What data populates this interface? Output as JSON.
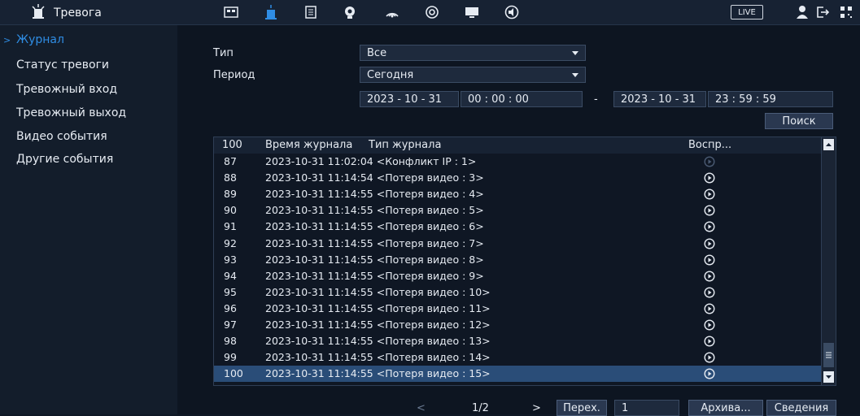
{
  "header": {
    "title": "Тревога",
    "live_label": "LIVE"
  },
  "sidebar": {
    "items": [
      {
        "label": "Журнал"
      },
      {
        "label": "Статус тревоги"
      },
      {
        "label": "Тревожный вход"
      },
      {
        "label": "Тревожный выход"
      },
      {
        "label": "Видео события"
      },
      {
        "label": "Другие события"
      }
    ]
  },
  "filter": {
    "type_label": "Тип",
    "type_value": "Все",
    "period_label": "Период",
    "period_value": "Сегодня",
    "start_date": "2023 - 10 - 31",
    "start_time": "00 : 00 : 00",
    "separator": "-",
    "end_date": "2023 - 10 - 31",
    "end_time": "23 : 59 : 59",
    "search_label": "Поиск"
  },
  "table": {
    "columns": [
      "100",
      "Время журнала",
      "Тип журнала",
      "Воспр..."
    ],
    "rows": [
      {
        "num": "87",
        "text": "2023-10-31 11:02:04 <Конфликт IP : 1>"
      },
      {
        "num": "88",
        "text": "2023-10-31 11:14:54 <Потеря видео : 3>"
      },
      {
        "num": "89",
        "text": "2023-10-31 11:14:55 <Потеря видео : 4>"
      },
      {
        "num": "90",
        "text": "2023-10-31 11:14:55 <Потеря видео : 5>"
      },
      {
        "num": "91",
        "text": "2023-10-31 11:14:55 <Потеря видео : 6>"
      },
      {
        "num": "92",
        "text": "2023-10-31 11:14:55 <Потеря видео : 7>"
      },
      {
        "num": "93",
        "text": "2023-10-31 11:14:55 <Потеря видео : 8>"
      },
      {
        "num": "94",
        "text": "2023-10-31 11:14:55 <Потеря видео : 9>"
      },
      {
        "num": "95",
        "text": "2023-10-31 11:14:55 <Потеря видео : 10>"
      },
      {
        "num": "96",
        "text": "2023-10-31 11:14:55 <Потеря видео : 11>"
      },
      {
        "num": "97",
        "text": "2023-10-31 11:14:55 <Потеря видео : 12>"
      },
      {
        "num": "98",
        "text": "2023-10-31 11:14:55 <Потеря видео : 13>"
      },
      {
        "num": "99",
        "text": "2023-10-31 11:14:55 <Потеря видео : 14>"
      },
      {
        "num": "100",
        "text": "2023-10-31 11:14:55 <Потеря видео : 15>"
      }
    ]
  },
  "pager": {
    "prev": "<",
    "page": "1/2",
    "next": ">",
    "goto_label": "Перех.",
    "goto_value": "1",
    "archive_label": "Архива...",
    "details_label": "Сведения"
  },
  "colors": {
    "accent": "#2f8de4",
    "background": "#0f1826",
    "selected_row": "#2a4d78"
  }
}
